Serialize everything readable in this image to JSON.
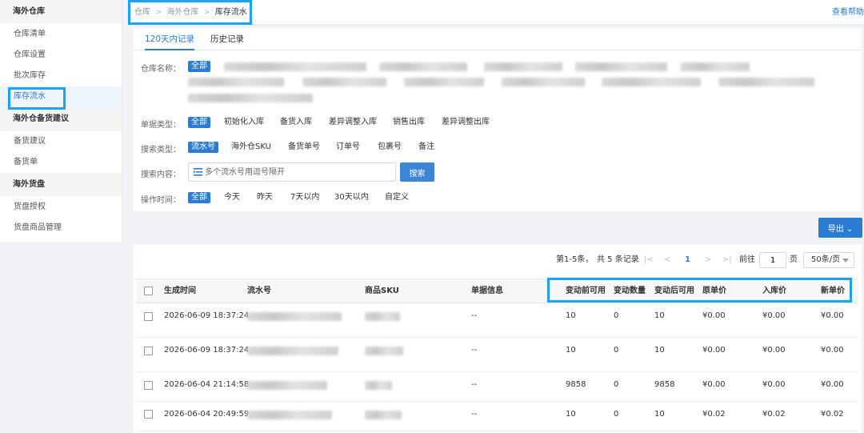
{
  "sidebar": {
    "groups": [
      {
        "title": "海外仓库",
        "items": [
          "仓库清单",
          "仓库设置",
          "批次库存",
          "库存流水"
        ]
      },
      {
        "title": "海外仓备货建议",
        "items": [
          "备货建议",
          "备货单"
        ]
      },
      {
        "title": "海外货盘",
        "items": [
          "货盘授权",
          "货盘商品管理"
        ]
      }
    ],
    "active_item": "库存流水"
  },
  "breadcrumb": [
    "仓库",
    "海外仓库",
    "库存流水"
  ],
  "breadcrumb_sep": ">",
  "help_link": "查看帮助",
  "tabs": [
    "120天内记录",
    "历史记录"
  ],
  "filters": {
    "warehouse": {
      "label": "仓库名称：",
      "all": "全部"
    },
    "doc_type": {
      "label": "单据类型：",
      "options": [
        "全部",
        "初始化入库",
        "备货入库",
        "差异调整入库",
        "销售出库",
        "差异调整出库"
      ]
    },
    "search_type": {
      "label": "搜索类型：",
      "options": [
        "流水号",
        "海外仓SKU",
        "备货单号",
        "订单号",
        "包裹号",
        "备注"
      ]
    },
    "search_content": {
      "label": "搜索内容：",
      "placeholder": "多个流水号用逗号隔开",
      "button": "搜索"
    },
    "op_time": {
      "label": "操作时间：",
      "options": [
        "全部",
        "今天",
        "昨天",
        "7天以内",
        "30天以内",
        "自定义"
      ]
    }
  },
  "export_button": "导出",
  "pagination": {
    "range": "第1-5条，",
    "total": "共 5 条记录",
    "current_page": "1",
    "goto_label": "前往",
    "goto_value": "1",
    "page_unit": "页",
    "page_size": "50条/页"
  },
  "table": {
    "columns": [
      "生成时间",
      "流水号",
      "商品SKU",
      "单据信息",
      "变动前可用",
      "变动数量",
      "变动后可用",
      "原单价",
      "入库价",
      "新单价"
    ],
    "rows": [
      {
        "time": "2026-06-09 18:37:24",
        "doc": "--",
        "before": "10",
        "change": "0",
        "after": "10",
        "orig_price": "¥0.00",
        "in_price": "¥0.00",
        "new_price": "¥0.00"
      },
      {
        "time": "2026-06-09 18:37:24",
        "doc": "--",
        "before": "10",
        "change": "0",
        "after": "10",
        "orig_price": "¥0.00",
        "in_price": "¥0.00",
        "new_price": "¥0.00"
      },
      {
        "time": "2026-06-04 21:14:58",
        "doc": "--",
        "before": "9858",
        "change": "0",
        "after": "9858",
        "orig_price": "¥0.00",
        "in_price": "¥0.00",
        "new_price": "¥0.00"
      },
      {
        "time": "2026-06-04 20:49:59",
        "doc": "--",
        "before": "10",
        "change": "0",
        "after": "10",
        "orig_price": "¥0.02",
        "in_price": "¥0.02",
        "new_price": "¥0.02"
      }
    ]
  },
  "colors": {
    "accent": "#2b7cd3",
    "highlight": "#1aa3f5"
  }
}
